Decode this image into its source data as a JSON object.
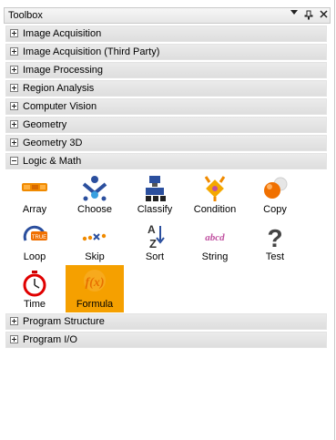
{
  "toolbox": {
    "title": "Toolbox",
    "dropdown_glyph": "▾",
    "pin_glyph": "ᵖ",
    "close_glyph": "×"
  },
  "categories": [
    {
      "label": "Image Acquisition",
      "expanded": false
    },
    {
      "label": "Image Acquisition (Third Party)",
      "expanded": false
    },
    {
      "label": "Image Processing",
      "expanded": false
    },
    {
      "label": "Region Analysis",
      "expanded": false
    },
    {
      "label": "Computer Vision",
      "expanded": false
    },
    {
      "label": "Geometry",
      "expanded": false
    },
    {
      "label": "Geometry 3D",
      "expanded": false
    },
    {
      "label": "Logic & Math",
      "expanded": true
    },
    {
      "label": "Program Structure",
      "expanded": false
    },
    {
      "label": "Program I/O",
      "expanded": false
    }
  ],
  "logic_math_tools": [
    {
      "label": "Array",
      "icon": "array-icon"
    },
    {
      "label": "Choose",
      "icon": "choose-icon"
    },
    {
      "label": "Classify",
      "icon": "classify-icon"
    },
    {
      "label": "Condition",
      "icon": "condition-icon"
    },
    {
      "label": "Copy",
      "icon": "copy-icon"
    },
    {
      "label": "Loop",
      "icon": "loop-icon"
    },
    {
      "label": "Skip",
      "icon": "skip-icon"
    },
    {
      "label": "Sort",
      "icon": "sort-icon"
    },
    {
      "label": "String",
      "icon": "string-icon"
    },
    {
      "label": "Test",
      "icon": "test-icon"
    },
    {
      "label": "Time",
      "icon": "time-icon"
    },
    {
      "label": "Formula",
      "icon": "formula-icon",
      "selected": true
    }
  ],
  "icon_text": {
    "loop": "TRUE",
    "skip": "••×•",
    "sort_a": "A",
    "sort_z": "Z",
    "string": "abcd",
    "test": "?",
    "formula": "f(x)"
  },
  "colors": {
    "accent_selected": "#f5a000",
    "category_bar": "#e3e3e3",
    "orange_icon": "#f08a00",
    "blue_icon": "#2b4f9e"
  }
}
